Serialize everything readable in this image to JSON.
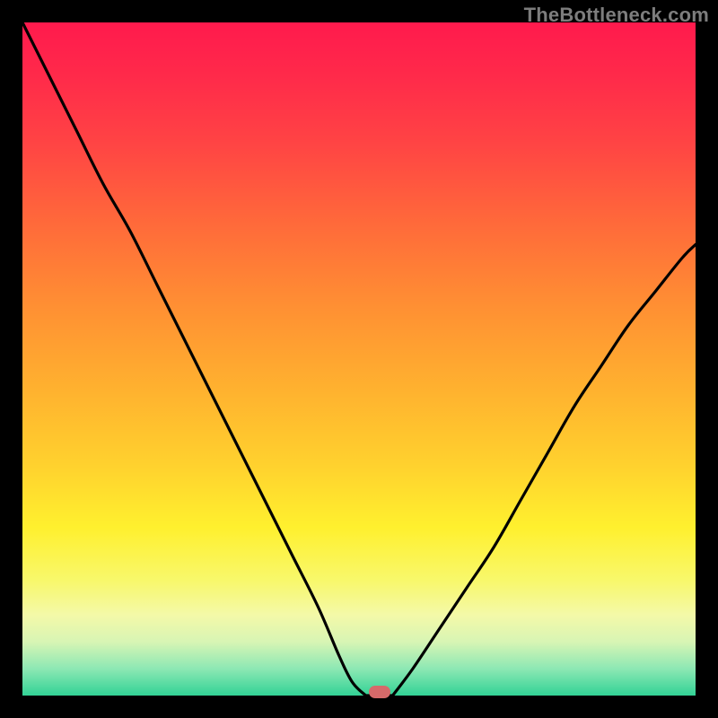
{
  "watermark": "TheBottleneck.com",
  "colors": {
    "frame": "#000000",
    "watermark": "#7d7d7d",
    "curve_stroke": "#000000",
    "marker_fill": "#d66a6a",
    "gradient_top": "#ff1a4d",
    "gradient_bottom": "#32d296"
  },
  "chart_data": {
    "type": "line",
    "title": "",
    "xlabel": "",
    "ylabel": "",
    "xlim": [
      0,
      100
    ],
    "ylim": [
      0,
      100
    ],
    "grid": false,
    "legend": false,
    "series": [
      {
        "name": "bottleneck-curve-left",
        "x": [
          0,
          4,
          8,
          12,
          16,
          20,
          24,
          28,
          32,
          36,
          40,
          44,
          47,
          49,
          51
        ],
        "y": [
          100,
          92,
          84,
          76,
          69,
          61,
          53,
          45,
          37,
          29,
          21,
          13,
          6,
          2,
          0
        ]
      },
      {
        "name": "bottleneck-curve-floor",
        "x": [
          51,
          53,
          55
        ],
        "y": [
          0,
          0,
          0
        ]
      },
      {
        "name": "bottleneck-curve-right",
        "x": [
          55,
          58,
          62,
          66,
          70,
          74,
          78,
          82,
          86,
          90,
          94,
          98,
          100
        ],
        "y": [
          0,
          4,
          10,
          16,
          22,
          29,
          36,
          43,
          49,
          55,
          60,
          65,
          67
        ]
      }
    ],
    "annotations": [
      {
        "name": "optimum-marker",
        "x": 53,
        "y": 0.5,
        "shape": "rounded-rect",
        "color": "#d66a6a"
      }
    ],
    "background": {
      "type": "vertical-gradient",
      "description": "red (high bottleneck) at top through orange/yellow to green (low bottleneck) at bottom"
    }
  }
}
